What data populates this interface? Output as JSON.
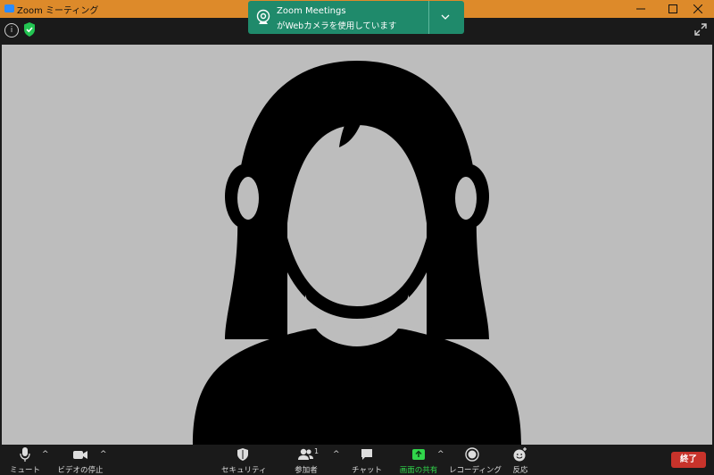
{
  "window": {
    "title": "Zoom ミーティング"
  },
  "notification": {
    "title": "Zoom Meetings",
    "message": "がWebカメラを使用しています"
  },
  "toolbar": {
    "mute_label": "ミュート",
    "video_label": "ビデオの停止",
    "security_label": "セキュリティ",
    "participants_label": "参加者",
    "participants_count": "1",
    "chat_label": "チャット",
    "share_label": "画面の共有",
    "record_label": "レコーディング",
    "reactions_label": "反応",
    "end_label": "終了"
  },
  "colors": {
    "titlebar": "#dd8a2a",
    "notification": "#1f8a6b",
    "share": "#31d64b",
    "end": "#c8332b"
  },
  "icons": [
    "zoom-app-icon",
    "info-icon",
    "shield-icon",
    "fullscreen-icon",
    "webcam-icon",
    "chevron-down-icon",
    "microphone-icon",
    "video-camera-icon",
    "security-shield-icon",
    "participants-icon",
    "chat-icon",
    "share-screen-icon",
    "record-icon",
    "reaction-icon"
  ]
}
